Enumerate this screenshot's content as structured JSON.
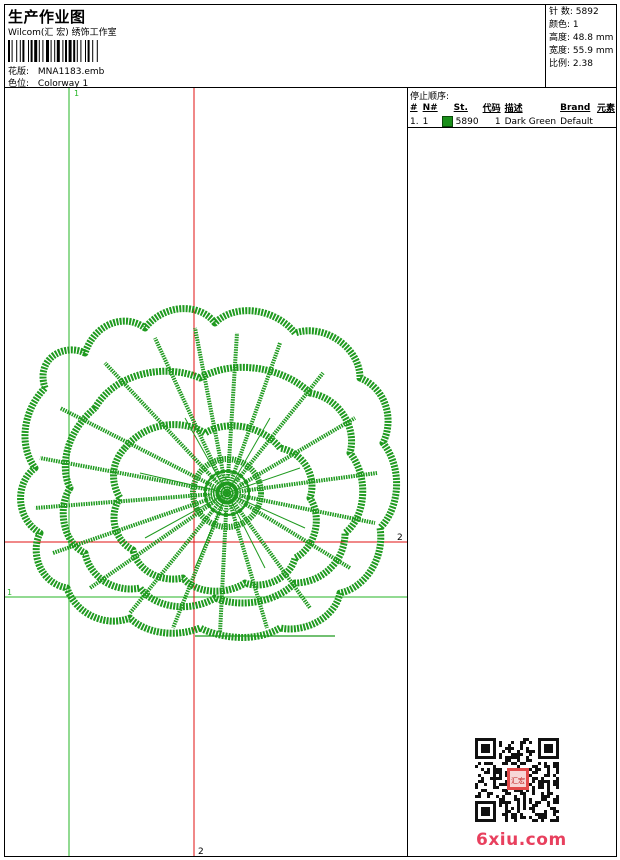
{
  "header": {
    "title": "生产作业图",
    "studio": "Wilcom(汇 宏) 绣饰工作室",
    "design_label": "花版:",
    "design_value": "MNA1183.emb",
    "colorway_label": "色位:",
    "colorway_value": "Colorway 1"
  },
  "stats": [
    {
      "label": "针 数:",
      "value": "5892"
    },
    {
      "label": "颜色:",
      "value": "1"
    },
    {
      "label": "高度:",
      "value": "48.8 mm"
    },
    {
      "label": "宽度:",
      "value": "55.9 mm"
    },
    {
      "label": "比例:",
      "value": "2.38"
    }
  ],
  "canvas": {
    "green_guide_label_top": "1",
    "green_guide_label_left": "1",
    "red_guide_label_bottom": "2",
    "red_guide_label_right": "2",
    "thread_color": "#1f9a1f",
    "guide_green": "#26b526",
    "guide_red": "#e01010"
  },
  "stop_sequence": {
    "title": "停止顺序:",
    "headers": [
      "#",
      "N#",
      "St.",
      "代码",
      "描述",
      "Brand",
      "元素"
    ],
    "rows": [
      {
        "num": "1.",
        "n": "1",
        "color": "#1a8f1a",
        "stitches": "5890",
        "code": "1",
        "description": "Dark Green",
        "brand": "Default",
        "element": ""
      }
    ]
  },
  "watermark": {
    "site": "6xiu.com",
    "seal_text": "汇宏"
  }
}
